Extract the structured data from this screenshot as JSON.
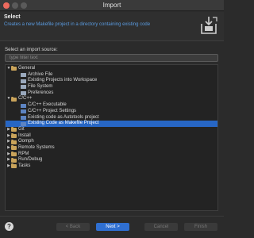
{
  "window": {
    "title": "Import"
  },
  "header": {
    "title": "Select",
    "description": "Creates a new Makefile project in a directory containing existing code"
  },
  "source": {
    "label": "Select an import source:",
    "filter_placeholder": "type filter text"
  },
  "tree": [
    {
      "label": "General",
      "level": 0,
      "expanded": true,
      "type": "folder"
    },
    {
      "label": "Archive File",
      "level": 1,
      "type": "doc"
    },
    {
      "label": "Existing Projects into Workspace",
      "level": 1,
      "type": "doc"
    },
    {
      "label": "File System",
      "level": 1,
      "type": "doc"
    },
    {
      "label": "Preferences",
      "level": 1,
      "type": "doc"
    },
    {
      "label": "C/C++",
      "level": 0,
      "expanded": true,
      "type": "folder"
    },
    {
      "label": "C/C++ Executable",
      "level": 1,
      "type": "cdoc"
    },
    {
      "label": "C/C++ Project Settings",
      "level": 1,
      "type": "cdoc"
    },
    {
      "label": "Existing code as Autotools project",
      "level": 1,
      "type": "cdoc"
    },
    {
      "label": "Existing Code as Makefile Project",
      "level": 1,
      "type": "cdoc",
      "selected": true
    },
    {
      "label": "Git",
      "level": 0,
      "expanded": false,
      "type": "folder"
    },
    {
      "label": "Install",
      "level": 0,
      "expanded": false,
      "type": "folder"
    },
    {
      "label": "Oomph",
      "level": 0,
      "expanded": false,
      "type": "folder"
    },
    {
      "label": "Remote Systems",
      "level": 0,
      "expanded": false,
      "type": "folder"
    },
    {
      "label": "RPM",
      "level": 0,
      "expanded": false,
      "type": "folder"
    },
    {
      "label": "Run/Debug",
      "level": 0,
      "expanded": false,
      "type": "folder"
    },
    {
      "label": "Tasks",
      "level": 0,
      "expanded": false,
      "type": "folder"
    }
  ],
  "buttons": {
    "help": "?",
    "back": "< Back",
    "next": "Next >",
    "cancel": "Cancel",
    "finish": "Finish"
  },
  "colors": {
    "accent": "#2f6fd1",
    "selection": "#2766c4",
    "description_text": "#5a9be0",
    "folder": "#c9a35a"
  }
}
